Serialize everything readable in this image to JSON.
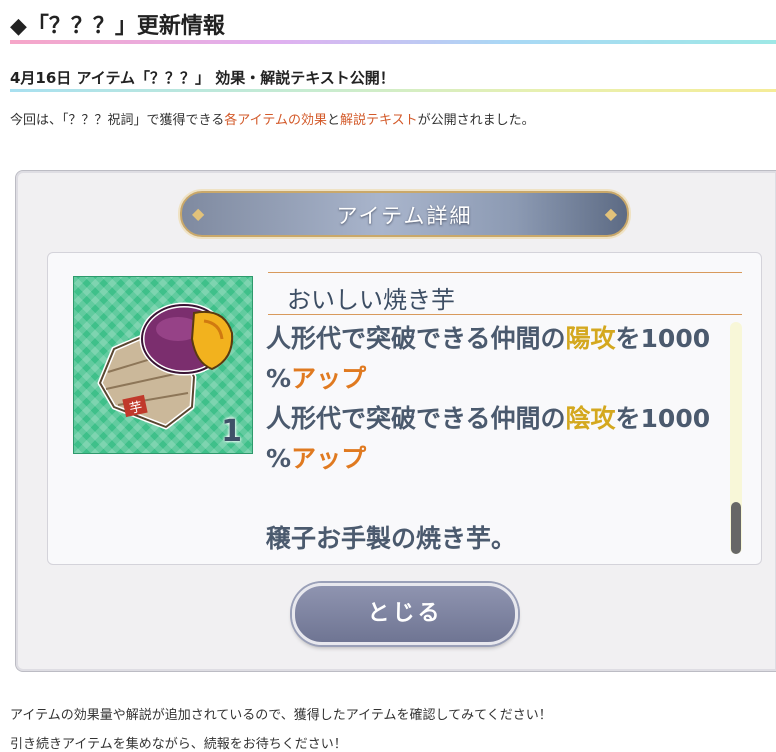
{
  "heading": "◆「？？？」更新情報",
  "subheading": "4月16日 アイテム「？？？」 効果・解説テキスト公開！",
  "intro": {
    "before": "今回は、「？？？祝詞」で獲得できる",
    "link1": "各アイテムの効果",
    "middle": "と",
    "link2": "解説テキスト",
    "after": "が公開されました。"
  },
  "game": {
    "banner_title": "アイテム詳細",
    "item_name": "おいしい焼き芋",
    "item_count": "1",
    "effect1_prefix": "人形代で突破できる仲間の",
    "effect1_attr": "陽攻",
    "effect1_suffix": "を1000",
    "effect1_unit": "%",
    "effect1_tail": "アップ",
    "effect2_prefix": "人形代で突破できる仲間の",
    "effect2_attr": "陰攻",
    "effect2_suffix": "を1000",
    "effect2_unit": "%",
    "effect2_tail": "アップ",
    "flavor": "穣子お手製の焼き芋。",
    "close_label": "とじる"
  },
  "footer": {
    "line1": "アイテムの効果量や解説が追加されているので、獲得したアイテムを確認してみてください！",
    "line2": "引き続きアイテムを集めながら、続報をお待ちください！"
  },
  "colors": {
    "highlight_link": "#d35a2a",
    "attr_yellow": "#d4a81f",
    "attr_orange": "#e07a20",
    "thumb_green": "#3fc08a"
  }
}
